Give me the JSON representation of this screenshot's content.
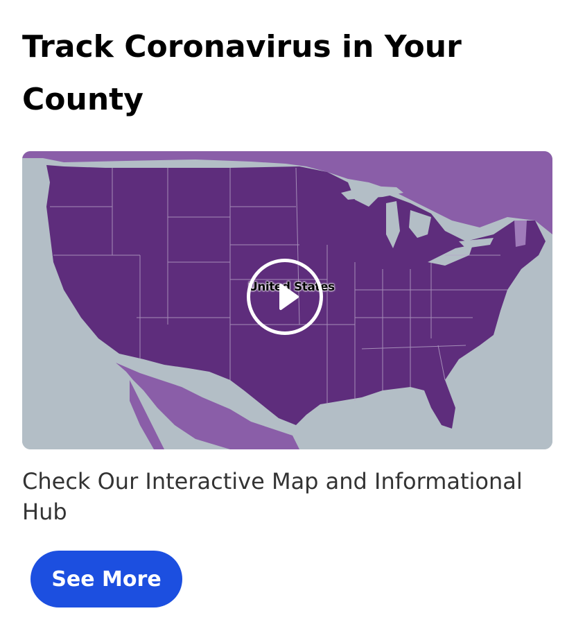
{
  "card": {
    "title": "Track Coronavirus in Your County",
    "description": "Check Our Interactive Map and Informational Hub",
    "button_label": "See More"
  },
  "media": {
    "type": "video-thumbnail",
    "map_label": "United States",
    "play_icon": "play-icon"
  },
  "colors": {
    "button_bg": "#1c4fe0",
    "map_states": "#5e2d7c",
    "map_neighbors": "#8a5ea8",
    "water": "#b3bec6"
  }
}
